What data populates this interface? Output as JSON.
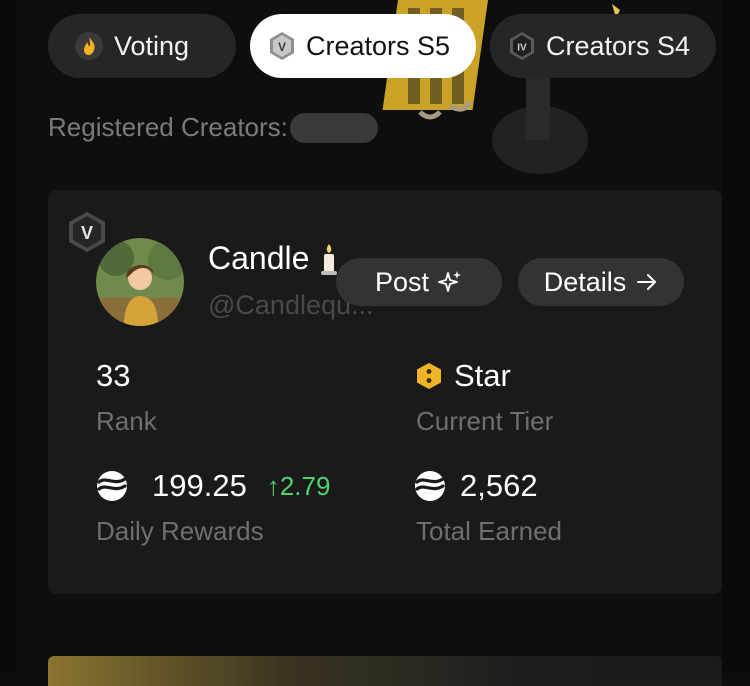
{
  "tabs": [
    {
      "label": "Voting",
      "icon": "flame-icon",
      "active": false
    },
    {
      "label": "Creators S5",
      "icon": "roman-five-badge-icon",
      "active": true
    },
    {
      "label": "Creators S4",
      "icon": "roman-four-badge-icon",
      "active": false
    }
  ],
  "registered": {
    "label": "Registered Creators:"
  },
  "card": {
    "tier_badge": "V",
    "name": "Candle",
    "handle": "@Candlequ...",
    "post_label": "Post",
    "details_label": "Details",
    "rank_value": "33",
    "rank_label": "Rank",
    "tier_value": "Star",
    "tier_label": "Current Tier",
    "daily_value": "199.25",
    "daily_delta": "2.79",
    "daily_label": "Daily Rewards",
    "total_value": "2,562",
    "total_label": "Total Earned"
  },
  "colors": {
    "accent_green": "#4fd36a",
    "tier_gold": "#f0b429",
    "card_bg": "#1a1a1a"
  }
}
